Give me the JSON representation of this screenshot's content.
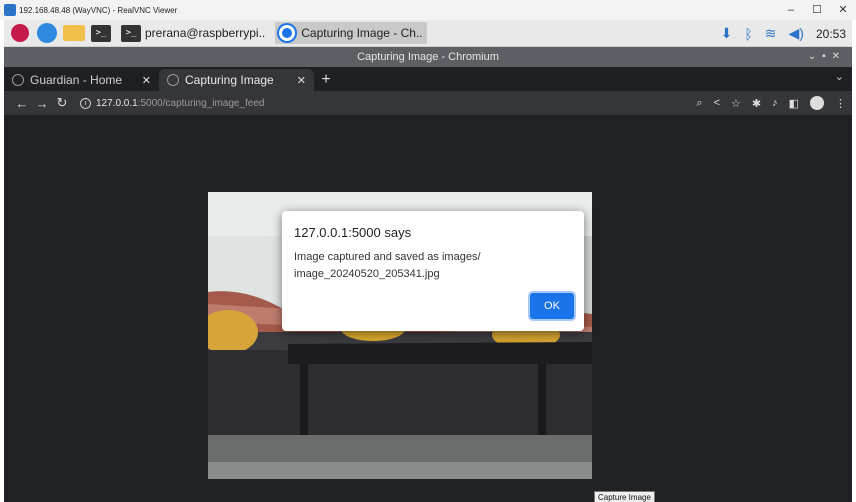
{
  "vnc": {
    "title": "192.168.48.48 (WayVNC) - RealVNC Viewer",
    "controls": [
      "–",
      "☐",
      "✕"
    ]
  },
  "taskbar": {
    "tasks": [
      {
        "label": "prerana@raspberrypi..",
        "icon": "terminal-icon",
        "active": false
      },
      {
        "label": "Capturing Image - Ch..",
        "icon": "chromium-icon",
        "active": true
      }
    ],
    "clock": "20:53",
    "tray_icons": [
      "download-icon",
      "bluetooth-icon",
      "wifi-icon",
      "volume-icon"
    ]
  },
  "chrome": {
    "window_title": "Capturing Image - Chromium",
    "tabs": [
      {
        "label": "Guardian - Home",
        "active": false
      },
      {
        "label": "Capturing Image",
        "active": true
      }
    ],
    "url_host": "127.0.0.1",
    "url_path": ":5000/capturing_image_feed"
  },
  "dialog": {
    "title": "127.0.0.1:5000 says",
    "message_line1": "Image captured and saved as images/",
    "message_line2": "image_20240520_205341.jpg",
    "ok_label": "OK"
  },
  "page": {
    "capture_button_label": "Capture Image"
  },
  "colors": {
    "accent": "#1a73e8",
    "chrome_dark": "#35363a",
    "page_bg": "#202124"
  }
}
